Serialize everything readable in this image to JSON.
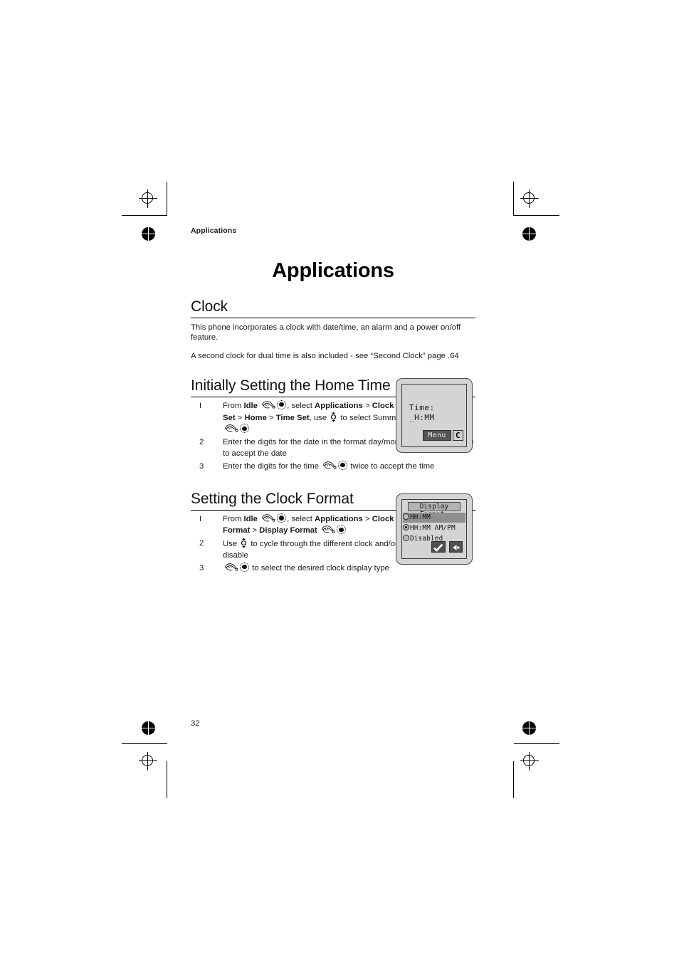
{
  "document": {
    "running_head": "Applications",
    "chapter_title": "Applications",
    "page_number": "32"
  },
  "clock_section": {
    "heading": "Clock",
    "paragraph_1": "This phone incorporates a clock with date/time, an alarm and a power on/off feature.",
    "paragraph_2": "A second clock for dual time is also included - see “Second Clock” page .64"
  },
  "home_time_section": {
    "heading": "Initially Setting the Home Time",
    "steps": [
      {
        "number": "I",
        "parts": [
          {
            "type": "text",
            "value": "From "
          },
          {
            "type": "bold",
            "value": "Idle"
          },
          {
            "type": "text",
            "value": " "
          },
          {
            "type": "icon",
            "value": "press-key-hand-icon"
          },
          {
            "type": "icon",
            "value": "select-button-icon"
          },
          {
            "type": "text",
            "value": ", select "
          },
          {
            "type": "bold",
            "value": "Applications"
          },
          {
            "type": "text",
            "value": " > "
          },
          {
            "type": "bold",
            "value": "Clock Function"
          },
          {
            "type": "text",
            "value": " > "
          },
          {
            "type": "bold",
            "value": "Clock Set"
          },
          {
            "type": "text",
            "value": " > "
          },
          {
            "type": "bold",
            "value": "Home"
          },
          {
            "type": "text",
            "value": " > "
          },
          {
            "type": "bold",
            "value": "Time Set"
          },
          {
            "type": "text",
            "value": ", use "
          },
          {
            "type": "icon",
            "value": "up-down-navigation-icon"
          },
          {
            "type": "text",
            "value": " to select  Summer Time on or off , "
          },
          {
            "type": "icon",
            "value": "press-key-hand-icon"
          },
          {
            "type": "icon",
            "value": "select-button-icon"
          }
        ]
      },
      {
        "number": "2",
        "parts": [
          {
            "type": "text",
            "value": "Enter the digits for the date in the format day/month/year "
          },
          {
            "type": "icon",
            "value": "press-key-hand-icon"
          },
          {
            "type": "icon",
            "value": "select-button-icon"
          },
          {
            "type": "text",
            "value": " twice to accept the date"
          }
        ]
      },
      {
        "number": "3",
        "parts": [
          {
            "type": "text",
            "value": "Enter the digits for the time "
          },
          {
            "type": "icon",
            "value": "press-key-hand-icon"
          },
          {
            "type": "icon",
            "value": "select-button-icon"
          },
          {
            "type": "text",
            "value": " twice to accept the time"
          }
        ]
      }
    ]
  },
  "clock_format_section": {
    "heading": "Setting the Clock Format",
    "steps": [
      {
        "number": "I",
        "parts": [
          {
            "type": "text",
            "value": "From "
          },
          {
            "type": "bold",
            "value": "Idle"
          },
          {
            "type": "text",
            "value": " "
          },
          {
            "type": "icon",
            "value": "press-key-hand-icon"
          },
          {
            "type": "icon",
            "value": "select-button-icon"
          },
          {
            "type": "text",
            "value": ", select "
          },
          {
            "type": "bold",
            "value": "Applications"
          },
          {
            "type": "text",
            "value": " > "
          },
          {
            "type": "bold",
            "value": "Clock Function"
          },
          {
            "type": "text",
            "value": " > "
          },
          {
            "type": "bold",
            "value": "Clock Format"
          },
          {
            "type": "text",
            "value": " > "
          },
          {
            "type": "bold",
            "value": "Display Format"
          },
          {
            "type": "text",
            "value": " "
          },
          {
            "type": "icon",
            "value": "press-key-hand-icon"
          },
          {
            "type": "icon",
            "value": "select-button-icon"
          }
        ]
      },
      {
        "number": "2",
        "parts": [
          {
            "type": "text",
            "value": "Use "
          },
          {
            "type": "icon",
            "value": "up-down-navigation-icon"
          },
          {
            "type": "text",
            "value": " to cycle through the different clock and/or date formats or disable"
          }
        ]
      },
      {
        "number": "3",
        "parts": [
          {
            "type": "icon",
            "value": "press-key-hand-icon"
          },
          {
            "type": "icon",
            "value": "select-button-icon"
          },
          {
            "type": "text",
            "value": " to select the desired clock display type"
          }
        ]
      }
    ]
  },
  "phone_screen_time": {
    "label_line": "Time:",
    "value_line": "_H:MM",
    "softkey_left": "Menu",
    "softkey_right": "C"
  },
  "phone_screen_display_format": {
    "title": "Display Format:",
    "options": [
      {
        "label": "HH:MM",
        "selected_row": true,
        "radio_on": false
      },
      {
        "label": "HH:MM AM/PM",
        "selected_row": false,
        "radio_on": true
      },
      {
        "label": "Disabled",
        "selected_row": false,
        "radio_on": false
      }
    ],
    "softkey_left": "confirm-check-icon",
    "softkey_right": "back-arrow-icon"
  },
  "colors": {
    "page_background": "#ffffff",
    "text": "#1a1a1a",
    "screen_background": "#d4d4d4",
    "screen_border": "#3c3c3c",
    "softkey_dark": "#545454",
    "highlight_row": "#8f8f8f",
    "title_bar": "#b3b3b3"
  }
}
